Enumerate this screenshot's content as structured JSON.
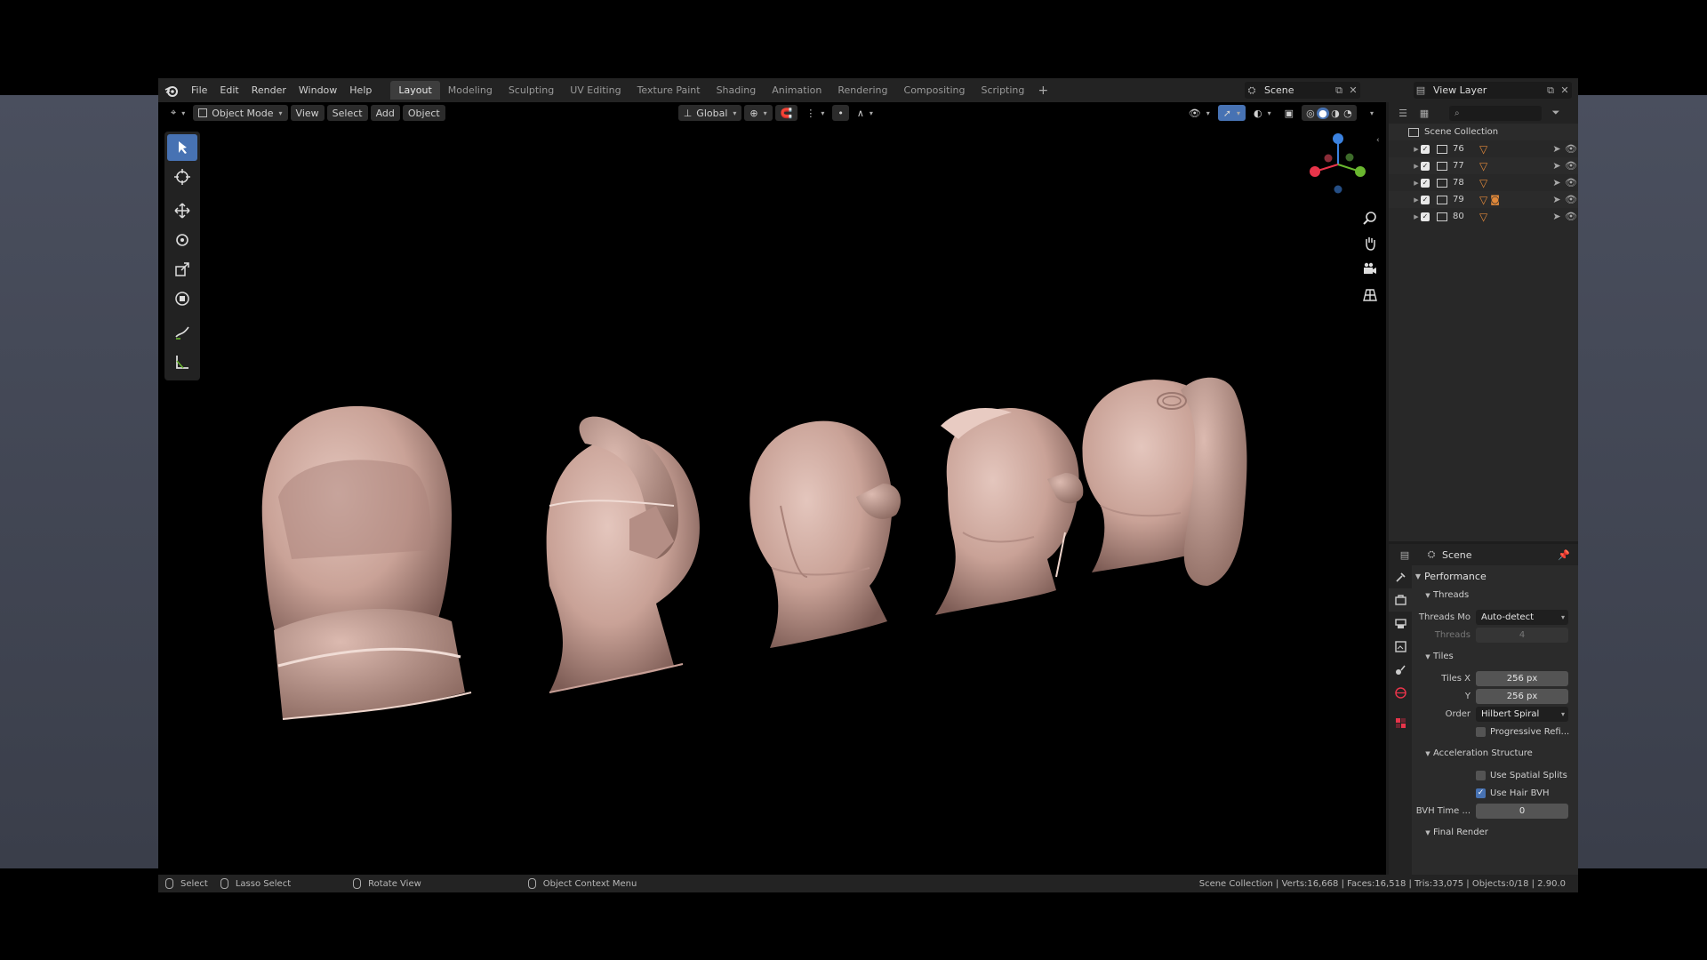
{
  "menu": [
    "File",
    "Edit",
    "Render",
    "Window",
    "Help"
  ],
  "workspaces": [
    "Layout",
    "Modeling",
    "Sculpting",
    "UV Editing",
    "Texture Paint",
    "Shading",
    "Animation",
    "Rendering",
    "Compositing",
    "Scripting"
  ],
  "active_workspace": "Layout",
  "scene_name": "Scene",
  "view_layer": "View Layer",
  "viewport_header": {
    "mode": "Object Mode",
    "menus": [
      "View",
      "Select",
      "Add",
      "Object"
    ],
    "orientation": "Global"
  },
  "outliner": {
    "root": "Scene Collection",
    "collections": [
      {
        "name": "76",
        "has_camera": false
      },
      {
        "name": "77",
        "has_camera": false
      },
      {
        "name": "78",
        "has_camera": false
      },
      {
        "name": "79",
        "has_camera": true
      },
      {
        "name": "80",
        "has_camera": false
      }
    ]
  },
  "properties": {
    "context": "Scene",
    "performance": "Performance",
    "threads_section": "Threads",
    "threads_mode_label": "Threads Mo",
    "threads_mode_value": "Auto-detect",
    "threads_label": "Threads",
    "threads_value": "4",
    "tiles_section": "Tiles",
    "tiles_x_label": "Tiles X",
    "tiles_x_value": "256 px",
    "tiles_y_label": "Y",
    "tiles_y_value": "256 px",
    "order_label": "Order",
    "order_value": "Hilbert Spiral",
    "progressive_label": "Progressive Refi...",
    "progressive_checked": false,
    "accel_section": "Acceleration Structure",
    "spatial_label": "Use Spatial Splits",
    "spatial_checked": false,
    "hair_bvh_label": "Use Hair BVH",
    "hair_bvh_checked": true,
    "bvh_time_label": "BVH Time ...",
    "bvh_time_value": "0",
    "final_render": "Final Render"
  },
  "status_bar": {
    "select": "Select",
    "lasso": "Lasso Select",
    "rotate": "Rotate View",
    "context_menu": "Object Context Menu",
    "stats": "Scene Collection | Verts:16,668 | Faces:16,518 | Tris:33,075 | Objects:0/18 | 2.90.0"
  },
  "colors": {
    "accent": "#4772b3",
    "head_skin": "#d9b5aa",
    "axis_x": "#e8344a",
    "axis_y": "#6ab72f",
    "axis_z": "#3b82e0"
  }
}
